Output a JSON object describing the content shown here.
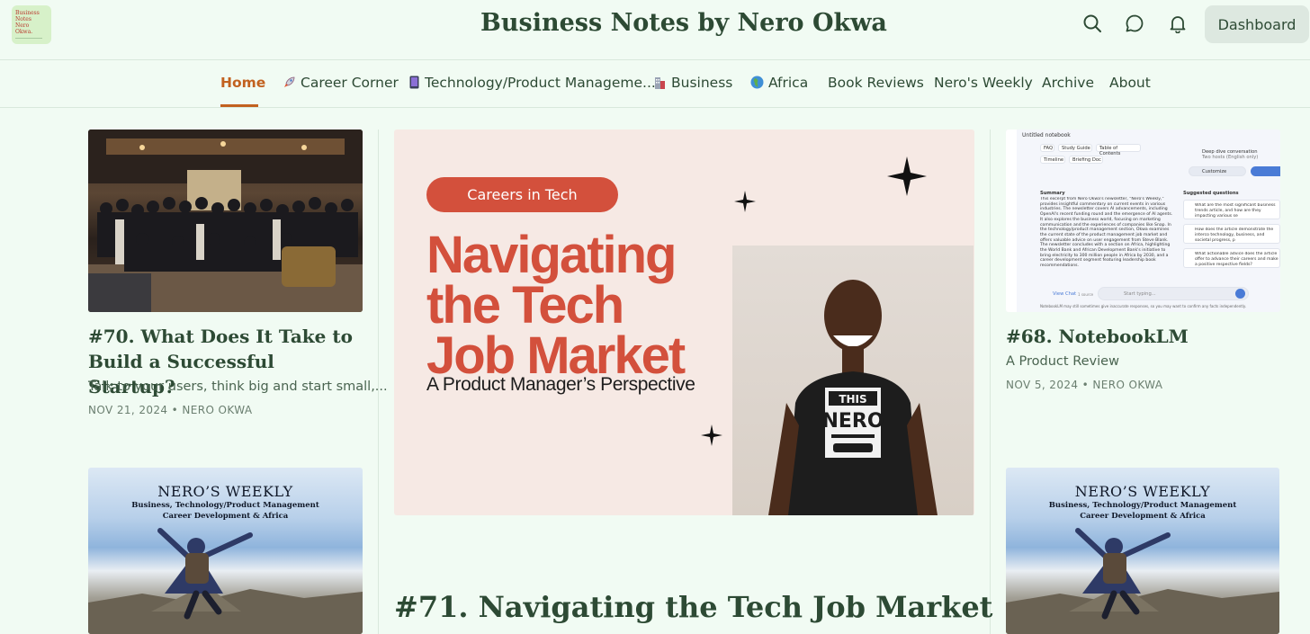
{
  "header": {
    "logo_lines": [
      "Business",
      "Notes",
      "Nero Okwa."
    ],
    "site_title": "Business Notes by Nero Okwa",
    "dashboard_label": "Dashboard"
  },
  "nav": {
    "items": [
      {
        "label": "Home",
        "icon": ""
      },
      {
        "label": "Career Corner",
        "icon": "rocket-icon"
      },
      {
        "label": "Technology/Product Manageme...",
        "icon": "phone-icon"
      },
      {
        "label": "Business",
        "icon": "building-icon"
      },
      {
        "label": "Africa",
        "icon": "globe-icon"
      },
      {
        "label": "Book Reviews",
        "icon": ""
      },
      {
        "label": "Nero's Weekly",
        "icon": ""
      },
      {
        "label": "Archive",
        "icon": ""
      },
      {
        "label": "About",
        "icon": ""
      }
    ]
  },
  "posts": {
    "left_top": {
      "title": "#70. What Does It Take to Build a Successful Startup?",
      "subtitle": "Talk to your users, think big and start small,...",
      "meta": "NOV 21, 2024 • NERO OKWA"
    },
    "featured": {
      "pill": "Careers in Tech",
      "headline_lines": [
        "Navigating",
        "the Tech",
        "Job Market"
      ],
      "image_subtitle": "A Product Manager’s Perspective",
      "shirt_text": [
        "THIS",
        "NERO"
      ],
      "title": "#71. Navigating the Tech Job Market"
    },
    "right_top": {
      "title": "#68. NotebookLM",
      "subtitle": "A Product Review",
      "meta": "NOV 5, 2024 • NERO OKWA",
      "screenshot": {
        "window_title": "Untitled notebook",
        "chips": [
          "FAQ",
          "Study Guide",
          "Table of Contents",
          "Timeline",
          "Briefing Doc"
        ],
        "deep_dive": "Deep dive conversation",
        "deep_dive_sub": "Two hosts (English only)",
        "customize": "Customize",
        "summary_heading": "Summary",
        "summary_text": "This excerpt from Nero Okwa's newsletter, \"Nero's Weekly,\" provides insightful commentary on current events in various industries. The newsletter covers AI advancements, including OpenAI's recent funding round and the emergence of AI agents. It also explores the business world, focusing on marketing communication and the experiences of companies like Snap. In the technology/product management section, Okwa examines the current state of the product management job market and offers valuable advice on user engagement from Steve Blank. The newsletter concludes with a section on Africa, highlighting the World Bank and African Development Bank's initiative to bring electricity to 300 million people in Africa by 2030, and a career development segment featuring leadership book recommendations.",
        "suggested_heading": "Suggested questions",
        "questions": [
          "What are the most significant business trends article, and how are they impacting various se",
          "How does the article demonstrate the interco technology, business, and societal progress, p",
          "What actionable advice does the article offer to advance their careers and make a positive respective fields?"
        ],
        "view_chat": "View Chat",
        "input_placeholder": "Start typing...",
        "source_count": "1 source",
        "disclaimer": "NotebookLM may still sometimes give inaccurate responses, so you may want to confirm any facts independently."
      }
    },
    "weekly_card": {
      "title": "NERO’S WEEKLY",
      "line1": "Business, Technology/Product Management",
      "line2": "Career Development & Africa"
    }
  },
  "colors": {
    "background": "#f1fbf3",
    "accent": "#c2611f",
    "text": "#2d4a34",
    "pill": "#d3503c"
  }
}
